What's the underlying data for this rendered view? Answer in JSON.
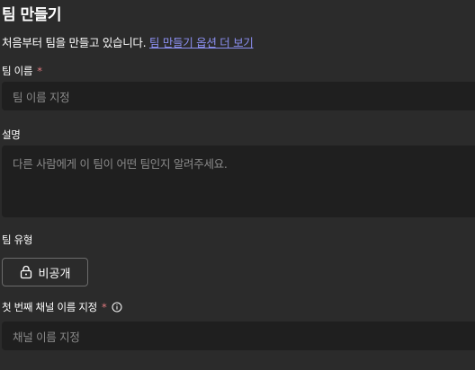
{
  "header": {
    "title": "팀 만들기"
  },
  "intro": {
    "text": "처음부터 팀을 만들고 있습니다.",
    "link_label": "팀 만들기 옵션 더 보기"
  },
  "team_name": {
    "label": "팀 이름",
    "required_mark": "*",
    "placeholder": "팀 이름 지정"
  },
  "description": {
    "label": "설명",
    "placeholder": "다른 사람에게 이 팀이 어떤 팀인지 알려주세요."
  },
  "team_type": {
    "label": "팀 유형",
    "selected_value": "비공개",
    "icon": "lock-icon"
  },
  "first_channel": {
    "label": "첫 번째 채널 이름 지정",
    "required_mark": "*",
    "info_icon": "info-icon",
    "placeholder": "채널 이름 지정"
  },
  "colors": {
    "background": "#2b2b2b",
    "field_background": "#1f1f1f",
    "link": "#8b8ff0",
    "required": "#e0797f",
    "placeholder": "#8a8a8a"
  }
}
